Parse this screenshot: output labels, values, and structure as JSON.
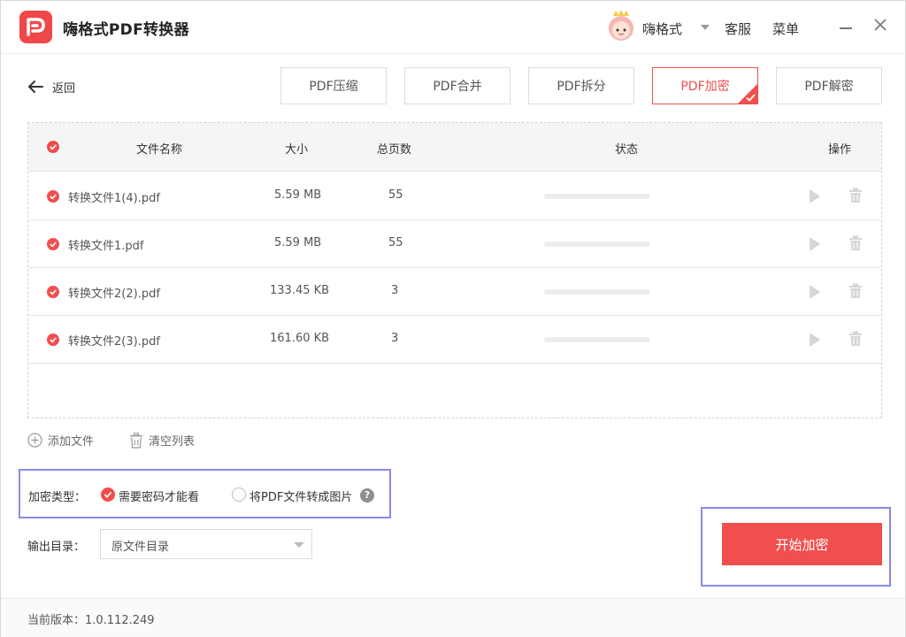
{
  "app": {
    "title": "嗨格式PDF转换器"
  },
  "header": {
    "username": "嗨格式",
    "service": "客服",
    "menu": "菜单"
  },
  "nav": {
    "back": "返回"
  },
  "tabs": [
    {
      "label": "PDF压缩",
      "active": false
    },
    {
      "label": "PDF合并",
      "active": false
    },
    {
      "label": "PDF拆分",
      "active": false
    },
    {
      "label": "PDF加密",
      "active": true
    },
    {
      "label": "PDF解密",
      "active": false
    }
  ],
  "table": {
    "headers": {
      "name": "文件名称",
      "size": "大小",
      "pages": "总页数",
      "status": "状态",
      "actions": "操作"
    },
    "rows": [
      {
        "name": "转换文件1(4).pdf",
        "size": "5.59 MB",
        "pages": "55"
      },
      {
        "name": "转换文件1.pdf",
        "size": "5.59 MB",
        "pages": "55"
      },
      {
        "name": "转换文件2(2).pdf",
        "size": "133.45 KB",
        "pages": "3"
      },
      {
        "name": "转换文件2(3).pdf",
        "size": "161.60 KB",
        "pages": "3"
      }
    ]
  },
  "toolbar": {
    "add_file": "添加文件",
    "clear_list": "清空列表"
  },
  "encrypt": {
    "label": "加密类型：",
    "option_password": "需要密码才能看",
    "option_image": "将PDF文件转成图片",
    "help": "?"
  },
  "output": {
    "label": "输出目录：",
    "value": "原文件目录"
  },
  "start": {
    "label": "开始加密"
  },
  "footer": {
    "version": "当前版本：1.0.112.249"
  },
  "colors": {
    "accent": "#f14e4e",
    "highlight": "#8a8ae8"
  }
}
